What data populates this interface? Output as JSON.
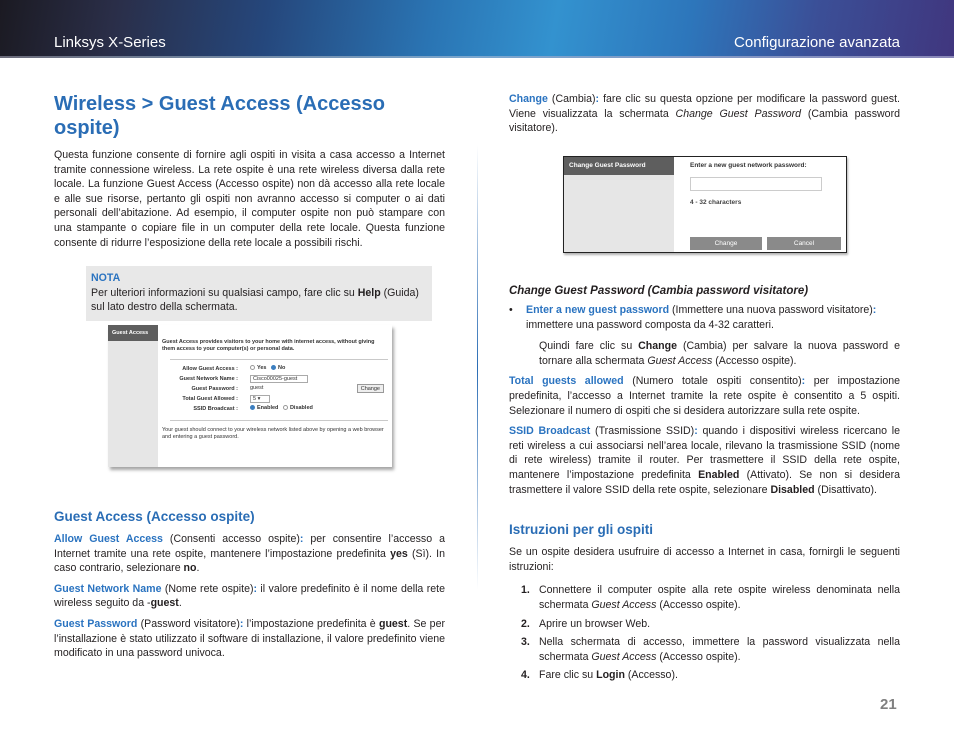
{
  "header": {
    "left_title": "Linksys X-Series",
    "right_title": "Configurazione avanzata"
  },
  "left": {
    "page_title": "Wireless > Guest Access (Accesso ospite)",
    "intro": "Questa funzione consente di fornire agli ospiti in visita a casa accesso a Internet tramite connessione wireless. La rete ospite è una rete wireless diversa dalla rete locale. La funzione Guest Access (Accesso ospite) non dà accesso alla rete locale e alle sue risorse, pertanto gli ospiti non avranno accesso si computer o ai dati personali dell’abitazione. Ad esempio, il computer ospite non può stampare con una stampante o copiare file in un computer della rete locale. Questa funzione consente di ridurre l’esposizione della rete locale a possibili rischi.",
    "note": {
      "title": "NOTA",
      "text_before": "Per ulteriori informazioni su qualsiasi campo, fare clic su ",
      "bold": "Help",
      "text_after": " (Guida) sul lato destro della schermata."
    },
    "screenshot": {
      "tab": "Guest Access",
      "description": "Guest Access provides visitors to your home with internet access, without giving them access to your computer(s) or personal data.",
      "fields": [
        {
          "label": "Allow Guest Access :",
          "options": [
            "Yes",
            "No"
          ],
          "selected": "No"
        },
        {
          "label": "Guest Network Name :",
          "value": "Cisco00025-guest"
        },
        {
          "label": "Guest Password :",
          "value": "guest",
          "button": "Change"
        },
        {
          "label": "Total Guest Allowed :",
          "value": "5"
        },
        {
          "label": "SSID Broadcast :",
          "options": [
            "Enabled",
            "Disabled"
          ],
          "selected": "Enabled"
        }
      ],
      "footer": "Your guest should connect to your wireless network listed above by opening a web browser and entering a guest password."
    },
    "section_title": "Guest Access (Accesso ospite)",
    "items": [
      {
        "term": "Allow Guest Access",
        "paren": " (Consenti accesso ospite)",
        "colon": ":",
        "t1": " per consentire l’accesso a Internet tramite una rete ospite, mantenere l’impostazione predefinita ",
        "b1": "yes",
        "t2": " (Sì). In caso contrario, selezionare ",
        "b2": "no",
        "t3": "."
      },
      {
        "term": "Guest Network Name",
        "paren": " (Nome rete ospite)",
        "colon": ":",
        "t1": " il valore predefinito è il nome della rete wireless seguito da -",
        "b1": "guest",
        "t2": "."
      },
      {
        "term": "Guest Password",
        "paren": " (Password visitatore)",
        "colon": ":",
        "t1": " l’impostazione predefinita è ",
        "b1": "guest",
        "t2": ". Se per l’installazione è stato utilizzato il software di installazione, il valore predefinito viene modificato in una password univoca."
      }
    ]
  },
  "right": {
    "change": {
      "term": "Change",
      "t1": " (Cambia)",
      "colon": ":",
      "t2": " fare clic su questa opzione per modificare la password guest. Viene visualizzata la schermata ",
      "i1": "Change Guest Password",
      "t3": " (Cambia password visitatore)."
    },
    "screenshot": {
      "tab": "Change Guest Password",
      "label": "Enter a new guest network password:",
      "input_value": "",
      "hint": "4 - 32 characters",
      "buttons": [
        "Change",
        "Cancel"
      ]
    },
    "subsection_title": "Change Guest Password (Cambia password visitatore)",
    "bullet": {
      "term": "Enter a new guest password",
      "paren": " (Immettere una nuova password visitatore)",
      "colon": ":",
      "t1": " immettere una password composta da 4-32 caratteri."
    },
    "indent": {
      "t1": "Quindi fare clic su ",
      "b1": "Change",
      "t2": " (Cambia) per salvare la nuova password e tornare alla schermata ",
      "i1": "Guest Access",
      "t3": " (Accesso ospite)."
    },
    "total": {
      "term": "Total guests allowed",
      "paren": " (Numero totale ospiti consentito)",
      "colon": ":",
      "t1": " per impostazione predefinita, l’accesso a Internet tramite la rete ospite è consentito a 5 ospiti. Selezionare il numero di ospiti che si desidera autorizzare sulla rete ospite."
    },
    "ssid": {
      "term": "SSID Broadcast",
      "paren": " (Trasmissione SSID)",
      "colon": ":",
      "t1": " quando i dispositivi wireless ricercano le reti wireless a cui associarsi nell’area locale, rilevano la trasmissione SSID (nome di rete wireless) tramite il router. Per trasmettere il SSID della rete ospite, mantenere l’impostazione predefinita ",
      "b1": "Enabled",
      "t2": " (Attivato). Se non si desidera trasmettere il valore SSID della rete ospite, selezionare ",
      "b2": "Disabled",
      "t3": " (Disattivato)."
    },
    "instructions_title": "Istruzioni per gli ospiti",
    "instructions_intro": "Se un ospite desidera usufruire di accesso a Internet in casa, fornirgli le seguenti istruzioni:",
    "steps": [
      {
        "num": "1.",
        "t1": "Connettere il computer ospite alla rete ospite wireless denominata nella schermata ",
        "i1": "Guest Access",
        "t2": " (Accesso ospite)."
      },
      {
        "num": "2.",
        "t1": "Aprire un browser Web."
      },
      {
        "num": "3.",
        "t1": "Nella schermata di accesso, immettere la password visualizzata nella schermata ",
        "i1": "Guest Access",
        "t2": " (Accesso ospite)."
      },
      {
        "num": "4.",
        "t1": "Fare clic su ",
        "b1": "Login",
        "t2": " (Accesso)."
      }
    ]
  },
  "page_number": "21"
}
